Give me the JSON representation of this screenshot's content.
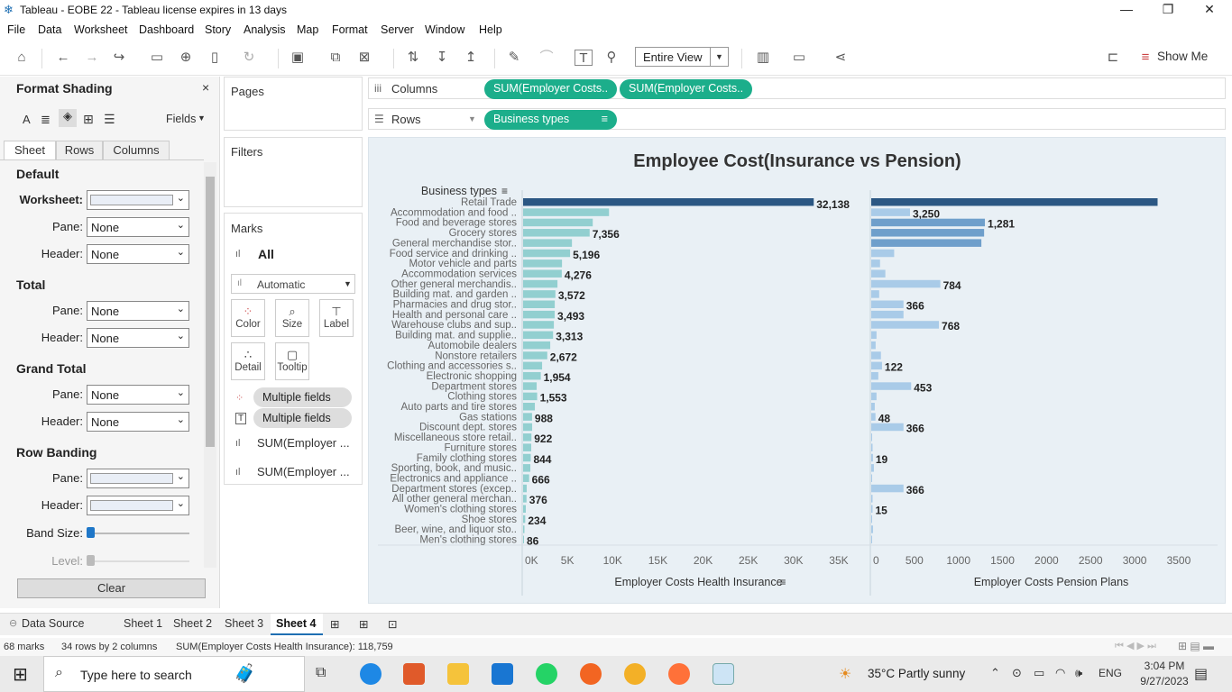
{
  "window": {
    "title": "Tableau - EOBE  22 - Tableau license expires in 13 days"
  },
  "menu": [
    "File",
    "Data",
    "Worksheet",
    "Dashboard",
    "Story",
    "Analysis",
    "Map",
    "Format",
    "Server",
    "Window",
    "Help"
  ],
  "toolbar": {
    "fit": "Entire View",
    "show_me": "Show Me"
  },
  "format_panel": {
    "title": "Format Shading",
    "fields_label": "Fields",
    "tabs": [
      "Sheet",
      "Rows",
      "Columns"
    ],
    "default_heading": "Default",
    "worksheet_label": "Worksheet:",
    "pane_label": "Pane:",
    "header_label": "Header:",
    "total_heading": "Total",
    "grand_total_heading": "Grand Total",
    "row_banding_heading": "Row Banding",
    "band_size_label": "Band Size:",
    "level_label": "Level:",
    "none": "None",
    "clear": "Clear"
  },
  "shelves": {
    "pages": "Pages",
    "filters": "Filters",
    "marks": "Marks",
    "marks_all": "All",
    "mark_type": "Automatic",
    "columns_label": "Columns",
    "rows_label": "Rows",
    "columns_pills": [
      "SUM(Employer Costs..",
      "SUM(Employer Costs.."
    ],
    "rows_pill": "Business types",
    "mark_buttons": [
      "Color",
      "Size",
      "Label",
      "Detail",
      "Tooltip"
    ],
    "mark_fields": [
      "Multiple fields",
      "Multiple fields",
      "SUM(Employer ...",
      "SUM(Employer ..."
    ]
  },
  "chart_data": {
    "type": "bar",
    "title": "Employee Cost(Insurance vs Pension)",
    "row_header": "Business types",
    "categories": [
      "Retail Trade",
      "Accommodation and food ..",
      "Food and beverage stores",
      "Grocery stores",
      "General merchandise stor..",
      "Food service and drinking ..",
      "Motor vehicle and parts",
      "Accommodation services",
      "Other general merchandis..",
      "Building mat. and garden ..",
      "Pharmacies and drug stor..",
      "Health and personal care ..",
      "Warehouse clubs and sup..",
      "Building mat. and supplie..",
      "Automobile dealers",
      "Nonstore retailers",
      "Clothing and accessories s..",
      "Electronic shopping",
      "Department stores",
      "Clothing stores",
      "Auto parts and tire stores",
      "Gas stations",
      "Discount dept. stores",
      "Miscellaneous store retail..",
      "Furniture stores",
      "Family clothing stores",
      "Sporting, book, and music..",
      "Electronics and appliance ..",
      "Department stores (excep..",
      "All other general merchan..",
      "Women's clothing stores",
      "Shoe stores",
      "Beer, wine, and liquor sto..",
      "Men's clothing stores"
    ],
    "series": [
      {
        "name": "Employer Costs Health Insurance",
        "values": [
          32138,
          9500,
          7700,
          7356,
          5400,
          5196,
          4300,
          4276,
          3800,
          3572,
          3500,
          3493,
          3400,
          3313,
          3000,
          2672,
          2100,
          1954,
          1500,
          1553,
          1300,
          988,
          1000,
          922,
          900,
          844,
          800,
          666,
          400,
          376,
          300,
          234,
          150,
          86
        ],
        "labels": {
          "Retail Trade": "32,138",
          "Grocery stores": "7,356",
          "Food service and drinking ..": "5,196",
          "Accommodation services": "4,276",
          "Building mat. and garden ..": "3,572",
          "Health and personal care ..": "3,493",
          "Building mat. and supplie..": "3,313",
          "Nonstore retailers": "2,672",
          "Electronic shopping": "1,954",
          "Clothing stores": "1,553",
          "Gas stations": "988",
          "Miscellaneous store retail..": "922",
          "Family clothing stores": "844",
          "Electronics and appliance ..": "666",
          "All other general merchan..": "376",
          "Shoe stores": "234",
          "Men's clothing stores": "86"
        }
      },
      {
        "name": "Employer Costs Pension Plans",
        "values": [
          3250,
          440,
          1290,
          1281,
          1250,
          260,
          100,
          160,
          784,
          90,
          366,
          366,
          768,
          60,
          50,
          110,
          122,
          80,
          453,
          60,
          40,
          48,
          366,
          10,
          15,
          19,
          30,
          8,
          366,
          15,
          15,
          5,
          20,
          10
        ],
        "labels": {
          "Accommodation and food ..": "3,250",
          "Food and beverage stores": "1,281",
          "Other general merchandis..": "784",
          "Pharmacies and drug stor..": "366",
          "Warehouse clubs and sup..": "768",
          "Clothing and accessories s..": "122",
          "Department stores": "453",
          "Gas stations": "48",
          "Discount dept. stores": "366",
          "Family clothing stores": "19",
          "Department stores (excep..": "366",
          "Women's clothing stores": "15"
        }
      }
    ],
    "axes": [
      {
        "title": "Employer Costs Health Insurance",
        "ticks": [
          "0K",
          "5K",
          "10K",
          "15K",
          "20K",
          "25K",
          "30K",
          "35K"
        ],
        "max": 37000
      },
      {
        "title": "Employer Costs Pension Plans",
        "ticks": [
          "0",
          "500",
          "1000",
          "1500",
          "2000",
          "2500",
          "3000",
          "3500"
        ],
        "max": 3900
      }
    ],
    "colors": {
      "dark": "#2b5783",
      "health_light": "#92cfd0",
      "pension_mid": "#6f9fcb",
      "pension_light": "#a9cbe8"
    }
  },
  "sheet_tabs": [
    "Data Source",
    "Sheet 1",
    "Sheet 2",
    "Sheet 3",
    "Sheet 4"
  ],
  "status": {
    "marks": "68 marks",
    "dims": "34 rows by 2 columns",
    "sum": "SUM(Employer Costs Health Insurance): 118,759"
  },
  "taskbar": {
    "search": "Type here to search",
    "weather": "35°C  Partly sunny",
    "lang": "ENG",
    "time": "3:04 PM",
    "date": "9/27/2023"
  }
}
